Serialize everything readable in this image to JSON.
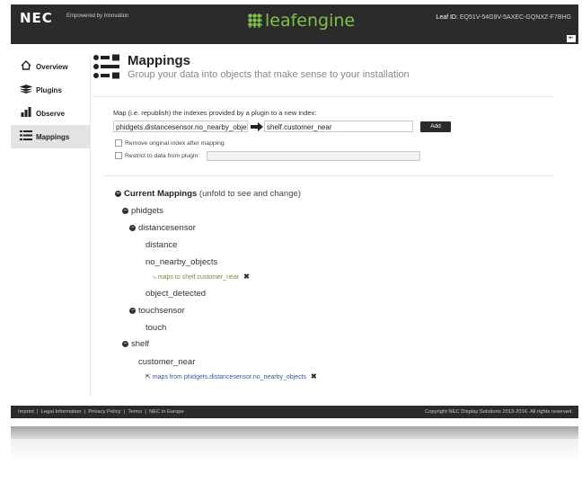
{
  "header": {
    "brand": "NEC",
    "tagline": "Empowered by Innovation",
    "logo_text": "leafengine",
    "leaf_id_label": "Leaf ID:",
    "leaf_id_value": "EQ51V-54G9V-5AXEC-GQNXZ-F7BHG"
  },
  "sidebar": {
    "items": [
      {
        "label": "Overview",
        "icon": "home-icon",
        "active": false
      },
      {
        "label": "Plugins",
        "icon": "stack-icon",
        "active": false
      },
      {
        "label": "Observe",
        "icon": "bar-chart-icon",
        "active": false
      },
      {
        "label": "Mappings",
        "icon": "list-icon",
        "active": true
      }
    ]
  },
  "page": {
    "title": "Mappings",
    "subtitle": "Group your data into objects that make sense to your installation"
  },
  "form": {
    "instruction": "Map (i.e. republish) the indexes provided by a plugin to a new index:",
    "source_value": "phidgets.distancesensor.no_nearby_objects",
    "target_value": "shelf.customer_near",
    "add_label": "Add",
    "remove_original_label": "Remove original index after mapping",
    "restrict_label": "Restrict to data from plugin:",
    "restrict_value": ""
  },
  "mappings": {
    "heading": "Current Mappings",
    "hint": "(unfold to see and change)",
    "tree": {
      "phidgets": "phidgets",
      "distancesensor": "distancesensor",
      "distance": "distance",
      "no_nearby_objects": "no_nearby_objects",
      "maps_to_prefix": "maps to",
      "maps_to_value": "shelf.customer_near",
      "object_detected": "object_detected",
      "touchsensor": "touchsensor",
      "touch": "touch",
      "shelf": "shelf",
      "customer_near": "customer_near",
      "maps_from_prefix": "maps from",
      "maps_from_value": "phidgets.distancesensor.no_nearby_objects"
    }
  },
  "footer": {
    "links": [
      "Imprint",
      "Legal Information",
      "Privacy Policy",
      "Terms",
      "NEC in Europe"
    ],
    "copyright": "Copyright NEC Display Solutions 2013-2016. All rights reserved."
  },
  "colors": {
    "header_bg": "#2b2b2b",
    "logo_green": "#7fc242",
    "active_nav": "#e3e3e3",
    "link_blue": "#2a5d9c"
  }
}
